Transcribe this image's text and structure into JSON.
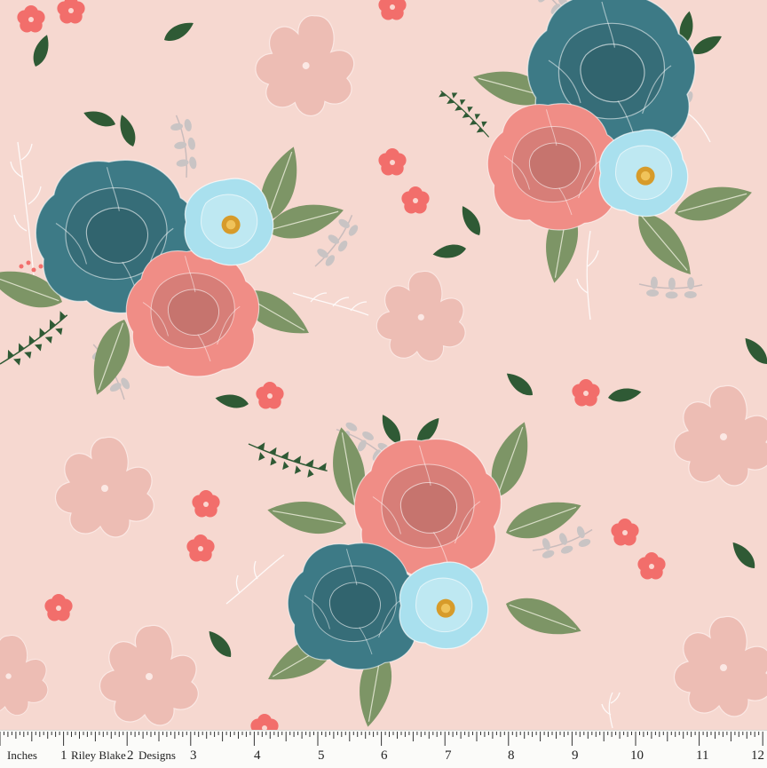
{
  "ruler": {
    "unit_label": "Inches",
    "brand_part1": "Riley Blake",
    "brand_part2": "Designs",
    "numbers": [
      "1",
      "2",
      "3",
      "4",
      "5",
      "6",
      "7",
      "8",
      "9",
      "10",
      "11",
      "12"
    ]
  },
  "colors": {
    "background": "#f6d8d0",
    "teal": "#3d7a86",
    "coral": "#f08d86",
    "light_blue": "#a9e0ee",
    "sage": "#7d9566",
    "dark_leaf": "#2f5a35",
    "ghost": "#edbdb4",
    "small_coral": "#f26e6b"
  }
}
